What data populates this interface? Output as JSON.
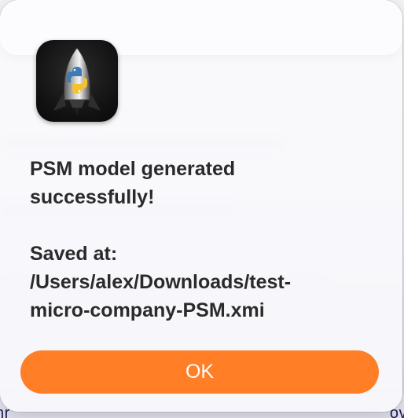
{
  "backdrop": {
    "bottom_left_fragment": "nr",
    "bottom_right_fragment": "ov"
  },
  "dialog": {
    "app_icon": "python-rocket-app-icon",
    "message_line1": "PSM model generated",
    "message_line2": "successfully!",
    "saved_label": "Saved at:",
    "path_line1": "/Users/alex/Downloads/test-",
    "path_line2": "micro-company-PSM.xmi",
    "ok_label": "OK"
  },
  "colors": {
    "accent": "#ff7e26",
    "text": "#2a2a2a"
  }
}
